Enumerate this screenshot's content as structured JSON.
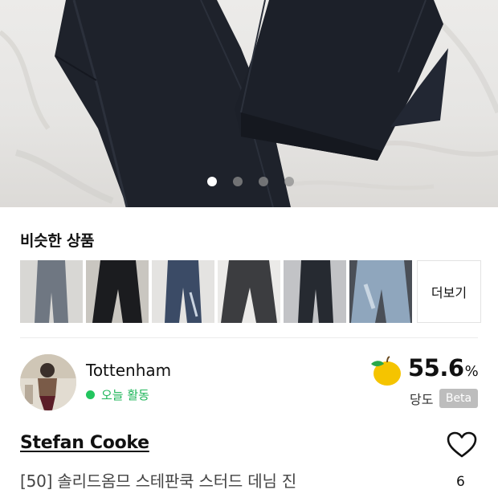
{
  "gallery": {
    "image_alt": "black denim jeans on white sheet",
    "page_count": 4,
    "active_index": 0
  },
  "similar": {
    "title": "비슷한 상품",
    "more_label": "더보기",
    "items": [
      {
        "name": "light-grey-jeans",
        "color": "#6f7782"
      },
      {
        "name": "black-jeans",
        "color": "#1b1c1f"
      },
      {
        "name": "washed-blue-jeans",
        "color": "#3b4b66"
      },
      {
        "name": "grey-black-jeans",
        "color": "#3c3d40"
      },
      {
        "name": "dark-jeans",
        "color": "#262a31"
      },
      {
        "name": "light-wash-jeans",
        "color": "#8fa6bd"
      }
    ]
  },
  "seller": {
    "name": "Tottenham",
    "activity": "오늘 활동",
    "sweetness_value": "55.6",
    "sweetness_unit": "%",
    "sweetness_label": "당도",
    "beta_label": "Beta"
  },
  "product": {
    "brand": "Stefan Cooke",
    "title": "[50] 솔리드옴므 스테판쿡 스터드 데님 진",
    "like_count": "6"
  },
  "colors": {
    "active_green": "#22c55e",
    "denim": "#1e222b",
    "apple_yellow": "#f5c400",
    "leaf_green": "#2aa84a"
  }
}
